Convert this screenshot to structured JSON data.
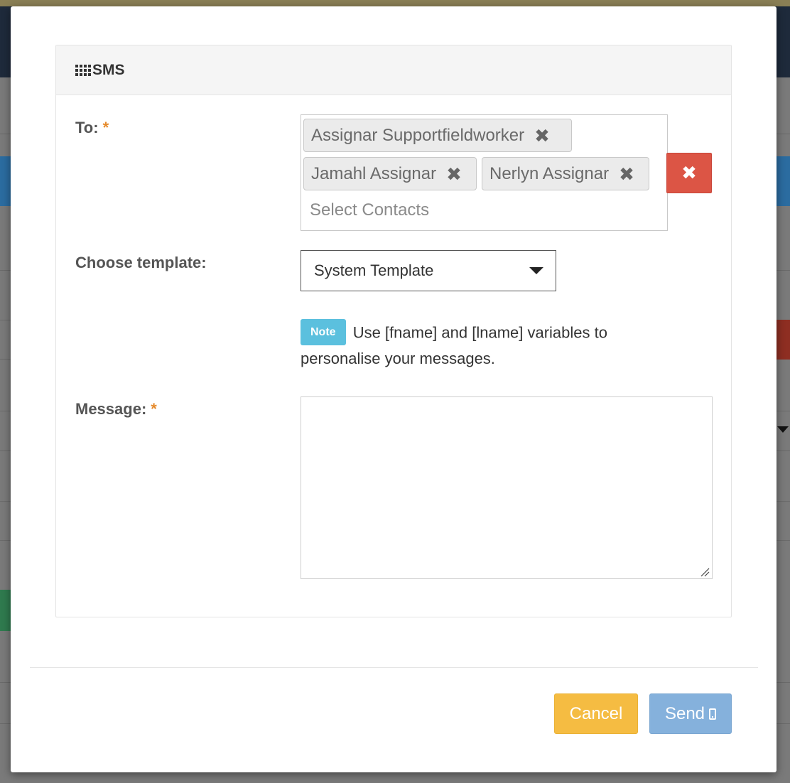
{
  "panel": {
    "title": "SMS",
    "icon": "grid-icon"
  },
  "form": {
    "to_label": "To:",
    "required_mark": "*",
    "recipients": [
      {
        "name": "Assignar Supportfieldworker"
      },
      {
        "name": "Jamahl Assignar"
      },
      {
        "name": "Nerlyn Assignar"
      }
    ],
    "remove_glyph": "✖",
    "recipients_placeholder": "Select Contacts",
    "clear_glyph": "✖",
    "template_label": "Choose template:",
    "template_selected": "System Template",
    "note_badge": "Note",
    "note_text": "Use [fname] and [lname] variables to personalise your messages.",
    "message_label": "Message:",
    "message_value": ""
  },
  "footer": {
    "cancel_label": "Cancel",
    "send_label": "Send"
  },
  "colors": {
    "danger": "#dc5545",
    "warning": "#f5bc42",
    "primary_disabled": "#85b1dc",
    "info": "#5bc0de",
    "required": "#e58a2b"
  }
}
